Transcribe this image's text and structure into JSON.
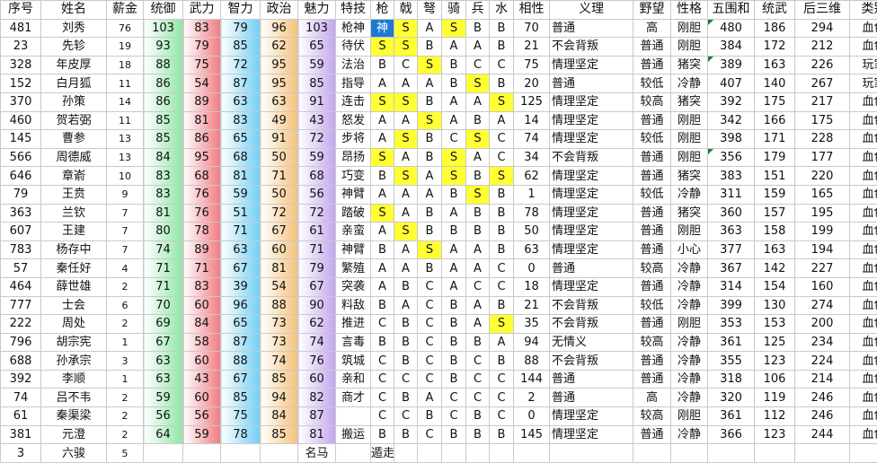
{
  "headers": [
    "序号",
    "姓名",
    "薪金",
    "统御",
    "武力",
    "智力",
    "政治",
    "魅力",
    "特技",
    "枪",
    "戟",
    "弩",
    "骑",
    "兵",
    "水",
    "相性",
    "义理",
    "野望",
    "性格",
    "五围和",
    "统武",
    "后三维",
    "类别"
  ],
  "column_colors": {
    "统御": [
      "#ffffff",
      "#8fe6a6"
    ],
    "武力": [
      "#ffffff",
      "#f27a82"
    ],
    "智力": [
      "#ffffff",
      "#72cff5"
    ],
    "政治": [
      "#ffffff",
      "#f5c27a"
    ],
    "魅力": [
      "#ffffff",
      "#c3a6ee"
    ]
  },
  "highlight_color": "#ffff33",
  "selection_color": "#1c79d6",
  "rows": [
    [
      "481",
      "刘秀",
      "76",
      "103",
      "83",
      "79",
      "96",
      "103",
      "枪神",
      "神",
      "S",
      "A",
      "S",
      "B",
      "B",
      "70",
      "普通",
      "高",
      "刚胆",
      "480",
      "186",
      "294",
      "血色"
    ],
    [
      "23",
      "先轸",
      "19",
      "93",
      "79",
      "85",
      "62",
      "65",
      "待伏",
      "S",
      "S",
      "B",
      "A",
      "A",
      "B",
      "21",
      "不会背叛",
      "普通",
      "刚胆",
      "384",
      "172",
      "212",
      "血色"
    ],
    [
      "328",
      "年皮厚",
      "18",
      "88",
      "75",
      "72",
      "95",
      "59",
      "法治",
      "B",
      "C",
      "S",
      "B",
      "C",
      "C",
      "75",
      "情理坚定",
      "普通",
      "猪突",
      "389",
      "163",
      "226",
      "玩家"
    ],
    [
      "152",
      "白月狐",
      "11",
      "86",
      "54",
      "87",
      "95",
      "85",
      "指导",
      "A",
      "A",
      "A",
      "B",
      "S",
      "B",
      "20",
      "普通",
      "较低",
      "冷静",
      "407",
      "140",
      "267",
      "玩家"
    ],
    [
      "370",
      "孙策",
      "14",
      "86",
      "89",
      "63",
      "63",
      "91",
      "连击",
      "S",
      "S",
      "B",
      "A",
      "A",
      "S",
      "125",
      "情理坚定",
      "较高",
      "猪突",
      "392",
      "175",
      "217",
      "血色"
    ],
    [
      "460",
      "贺若弼",
      "11",
      "85",
      "81",
      "83",
      "49",
      "43",
      "怒发",
      "A",
      "A",
      "S",
      "A",
      "B",
      "A",
      "14",
      "情理坚定",
      "普通",
      "刚胆",
      "342",
      "166",
      "175",
      "血色"
    ],
    [
      "145",
      "曹参",
      "13",
      "85",
      "86",
      "65",
      "91",
      "72",
      "步将",
      "A",
      "S",
      "B",
      "C",
      "S",
      "C",
      "74",
      "情理坚定",
      "较低",
      "刚胆",
      "398",
      "171",
      "228",
      "血色"
    ],
    [
      "566",
      "周德威",
      "13",
      "84",
      "95",
      "68",
      "50",
      "59",
      "昂扬",
      "S",
      "A",
      "B",
      "S",
      "A",
      "C",
      "34",
      "不会背叛",
      "普通",
      "刚胆",
      "356",
      "179",
      "177",
      "血色"
    ],
    [
      "646",
      "章嵛",
      "10",
      "83",
      "68",
      "81",
      "71",
      "68",
      "巧变",
      "B",
      "S",
      "A",
      "S",
      "B",
      "S",
      "62",
      "情理坚定",
      "普通",
      "猪突",
      "383",
      "151",
      "220",
      "血色"
    ],
    [
      "79",
      "王贲",
      "9",
      "83",
      "76",
      "59",
      "50",
      "56",
      "神臂",
      "A",
      "A",
      "A",
      "B",
      "S",
      "B",
      "1",
      "情理坚定",
      "较低",
      "冷静",
      "311",
      "159",
      "165",
      "血色"
    ],
    [
      "363",
      "兰钦",
      "7",
      "81",
      "76",
      "51",
      "72",
      "72",
      "踏破",
      "S",
      "A",
      "B",
      "A",
      "B",
      "B",
      "78",
      "情理坚定",
      "普通",
      "猪突",
      "360",
      "157",
      "195",
      "血色"
    ],
    [
      "607",
      "王建",
      "7",
      "80",
      "78",
      "71",
      "67",
      "61",
      "亲蛮",
      "A",
      "S",
      "B",
      "B",
      "B",
      "B",
      "50",
      "情理坚定",
      "普通",
      "刚胆",
      "363",
      "158",
      "199",
      "血色"
    ],
    [
      "783",
      "杨存中",
      "7",
      "74",
      "89",
      "63",
      "60",
      "71",
      "神臂",
      "B",
      "A",
      "S",
      "A",
      "A",
      "B",
      "63",
      "情理坚定",
      "普通",
      "小心",
      "377",
      "163",
      "194",
      "血色"
    ],
    [
      "57",
      "秦任好",
      "4",
      "71",
      "71",
      "67",
      "81",
      "79",
      "繁殖",
      "A",
      "A",
      "B",
      "A",
      "A",
      "C",
      "0",
      "普通",
      "较高",
      "冷静",
      "367",
      "142",
      "227",
      "血色"
    ],
    [
      "464",
      "薛世雄",
      "2",
      "71",
      "83",
      "39",
      "54",
      "67",
      "突袭",
      "A",
      "B",
      "C",
      "A",
      "C",
      "C",
      "18",
      "情理坚定",
      "普通",
      "冷静",
      "314",
      "154",
      "160",
      "血色"
    ],
    [
      "777",
      "士会",
      "6",
      "70",
      "60",
      "96",
      "88",
      "90",
      "料敌",
      "B",
      "A",
      "C",
      "B",
      "A",
      "B",
      "21",
      "不会背叛",
      "较低",
      "冷静",
      "399",
      "130",
      "274",
      "血色"
    ],
    [
      "222",
      "周处",
      "2",
      "69",
      "84",
      "65",
      "73",
      "62",
      "推进",
      "C",
      "B",
      "C",
      "B",
      "A",
      "S",
      "35",
      "不会背叛",
      "普通",
      "刚胆",
      "353",
      "153",
      "200",
      "血色"
    ],
    [
      "796",
      "胡宗宪",
      "1",
      "67",
      "58",
      "87",
      "73",
      "74",
      "言毒",
      "B",
      "B",
      "C",
      "B",
      "B",
      "A",
      "94",
      "无情义",
      "较高",
      "冷静",
      "361",
      "125",
      "234",
      "血色"
    ],
    [
      "688",
      "孙承宗",
      "3",
      "63",
      "60",
      "88",
      "74",
      "76",
      "筑城",
      "C",
      "B",
      "C",
      "B",
      "C",
      "B",
      "88",
      "不会背叛",
      "普通",
      "冷静",
      "355",
      "123",
      "224",
      "血色"
    ],
    [
      "392",
      "李顺",
      "1",
      "63",
      "43",
      "67",
      "85",
      "60",
      "亲和",
      "C",
      "C",
      "C",
      "B",
      "C",
      "C",
      "144",
      "普通",
      "普通",
      "冷静",
      "318",
      "106",
      "214",
      "血色"
    ],
    [
      "74",
      "吕不韦",
      "2",
      "59",
      "60",
      "85",
      "94",
      "82",
      "商才",
      "C",
      "B",
      "A",
      "C",
      "C",
      "C",
      "2",
      "普通",
      "高",
      "冷静",
      "320",
      "119",
      "246",
      "血色"
    ],
    [
      "61",
      "秦渠梁",
      "2",
      "56",
      "56",
      "75",
      "84",
      "87",
      "",
      "C",
      "C",
      "B",
      "C",
      "B",
      "C",
      "0",
      "情理坚定",
      "较高",
      "刚胆",
      "361",
      "112",
      "246",
      "血色"
    ],
    [
      "381",
      "元澄",
      "2",
      "64",
      "59",
      "78",
      "85",
      "81",
      "搬运",
      "B",
      "B",
      "C",
      "B",
      "B",
      "B",
      "145",
      "情理坚定",
      "普通",
      "冷静",
      "366",
      "123",
      "244",
      "血色"
    ]
  ],
  "highlights": [
    [
      0,
      10
    ],
    [
      0,
      12
    ],
    [
      1,
      9
    ],
    [
      1,
      10
    ],
    [
      2,
      11
    ],
    [
      3,
      13
    ],
    [
      4,
      9
    ],
    [
      4,
      10
    ],
    [
      4,
      14
    ],
    [
      5,
      11
    ],
    [
      6,
      10
    ],
    [
      6,
      13
    ],
    [
      7,
      9
    ],
    [
      7,
      12
    ],
    [
      8,
      10
    ],
    [
      8,
      12
    ],
    [
      8,
      14
    ],
    [
      9,
      13
    ],
    [
      10,
      9
    ],
    [
      11,
      10
    ],
    [
      12,
      11
    ],
    [
      16,
      14
    ]
  ],
  "selected": [
    0,
    9
  ],
  "marked": [
    [
      0,
      19
    ],
    [
      2,
      19
    ],
    [
      7,
      19
    ]
  ],
  "last_row": [
    "3",
    "六骏",
    "5",
    "",
    "",
    "",
    "",
    "名马",
    "",
    "遁走",
    "",
    "",
    "",
    "",
    "",
    "",
    "",
    "",
    "",
    "",
    "",
    "",
    ""
  ]
}
